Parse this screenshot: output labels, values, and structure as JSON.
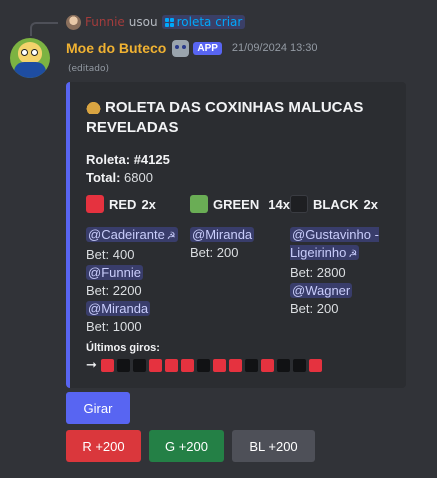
{
  "reply": {
    "user": "Funnie",
    "verb": "usou",
    "command": "roleta criar"
  },
  "message": {
    "author": "Moe do Buteco",
    "badge": "APP",
    "timestamp": "21/09/2024 13:30",
    "edited": "(editado)"
  },
  "embed": {
    "accent": "#5865f2",
    "title": "ROLETA DAS COXINHAS MALUCAS REVELADAS",
    "roulette_label": "Roleta:",
    "roulette_id": "#4125",
    "total_label": "Total:",
    "total_value": "6800",
    "columns": [
      {
        "color": "#e5323f",
        "label": "RED",
        "mult": "2x",
        "entries": [
          {
            "user": "@Cadeirante",
            "has_icon": true,
            "bet": "Bet: 400"
          },
          {
            "user": "@Funnie",
            "has_icon": false,
            "bet": "Bet: 2200"
          },
          {
            "user": "@Miranda",
            "has_icon": false,
            "bet": "Bet: 1000"
          }
        ]
      },
      {
        "color": "#6aad55",
        "label": "GREEN",
        "mult": "14x",
        "entries": [
          {
            "user": "@Miranda",
            "has_icon": false,
            "bet": "Bet: 200"
          }
        ]
      },
      {
        "color": "#2b2d31",
        "label": "BLACK",
        "mult": "2x",
        "entries": [
          {
            "user": "@Gustavinho - Ligeirinho",
            "has_icon": true,
            "bet": "Bet: 2800"
          },
          {
            "user": "@Wagner",
            "has_icon": false,
            "bet": "Bet: 200"
          }
        ]
      }
    ],
    "last_spins_label": "Últimos giros:",
    "last_spins": [
      "red",
      "black",
      "black",
      "red",
      "red",
      "red",
      "black",
      "red",
      "red",
      "black",
      "red",
      "black",
      "black",
      "red"
    ]
  },
  "buttons": {
    "spin": "Girar",
    "red": "R +200",
    "green": "G +200",
    "black": "BL +200"
  },
  "colors": {
    "background": "#313338",
    "embed_bg": "#2b2d31",
    "author": "#f0b232",
    "blurple": "#5865f2",
    "danger": "#da373c",
    "success": "#248046",
    "secondary": "#4e5058",
    "spin_red": "#e5323f",
    "spin_black": "#111214"
  },
  "icons": {
    "reply_avatar": "user-avatar-icon",
    "command": "slash-command-icon",
    "bot_avatar": "bot-avatar-icon",
    "robot": "robot-emoji-icon",
    "title": "money-bag-icon",
    "mention_extra": "hammer-sickle-icon",
    "spins_arrow": "right-arrow-icon"
  }
}
